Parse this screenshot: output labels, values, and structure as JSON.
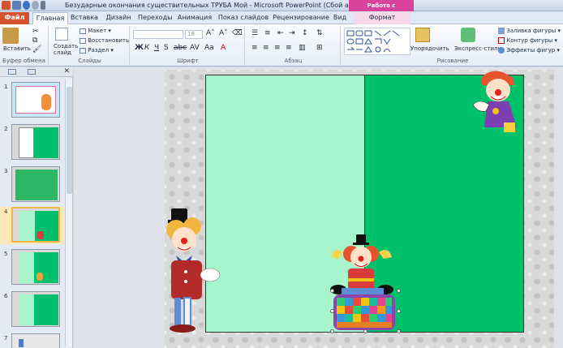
{
  "window": {
    "title": "Безударные окончания существительных ТРУБА  Мой  -  Microsoft PowerPoint (Сбой активации про...",
    "contextual_tool": "Работа с рисунками"
  },
  "tabs": [
    {
      "label": "Файл"
    },
    {
      "label": "Главная"
    },
    {
      "label": "Вставка"
    },
    {
      "label": "Дизайн"
    },
    {
      "label": "Переходы"
    },
    {
      "label": "Анимация"
    },
    {
      "label": "Показ слайдов"
    },
    {
      "label": "Рецензирование"
    },
    {
      "label": "Вид"
    },
    {
      "label": "Формат"
    }
  ],
  "ribbon": {
    "clipboard": {
      "paste": "Вставить",
      "group": "Буфер обмена"
    },
    "slides": {
      "new_slide": "Создать слайд",
      "layout": "Макет",
      "reset": "Восстановить",
      "section": "Раздел",
      "group": "Слайды"
    },
    "font": {
      "size": "18",
      "group": "Шрифт"
    },
    "paragraph": {
      "group": "Абзац"
    },
    "drawing": {
      "arrange": "Упорядочить",
      "quick_styles": "Экспресс-стили",
      "fill": "Заливка фигуры",
      "outline": "Контур фигуры",
      "effects": "Эффекты фигур",
      "group": "Рисование"
    }
  },
  "slides_panel": {
    "thumbnails": [
      {
        "num": "1"
      },
      {
        "num": "2"
      },
      {
        "num": "3"
      },
      {
        "num": "4"
      },
      {
        "num": "5"
      },
      {
        "num": "6"
      },
      {
        "num": "7"
      }
    ]
  },
  "colors": {
    "light_green": "#a6f5cc",
    "green": "#00c16b",
    "file_tab": "#d35230",
    "context_pink": "#d9429c"
  }
}
